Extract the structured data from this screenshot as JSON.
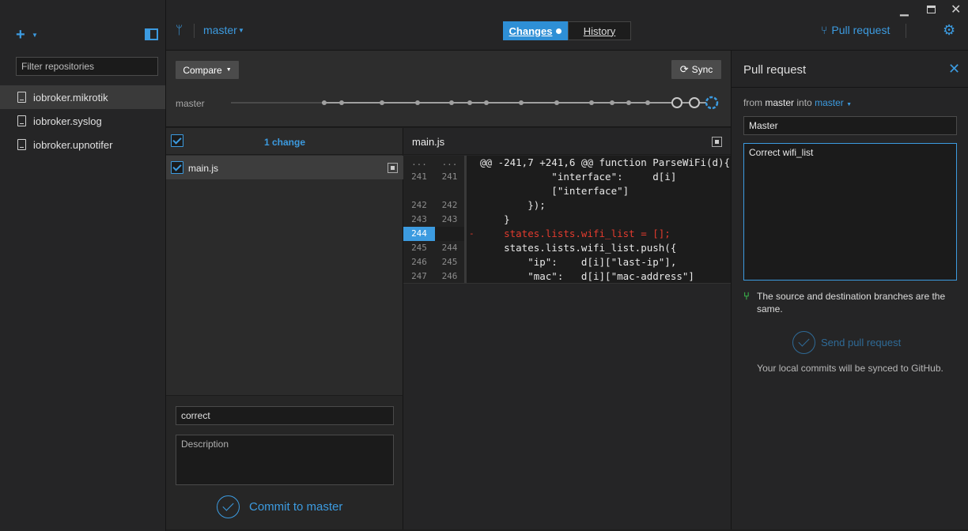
{
  "sidebar": {
    "filter_placeholder": "Filter repositories",
    "repos": [
      {
        "name": "iobroker.mikrotik",
        "active": true
      },
      {
        "name": "iobroker.syslog",
        "active": false
      },
      {
        "name": "iobroker.upnotifer",
        "active": false
      }
    ]
  },
  "topbar": {
    "branch": "master",
    "tabs": {
      "changes": "Changes",
      "history": "History"
    },
    "pull_request": "Pull request"
  },
  "compare": {
    "compare_label": "Compare",
    "sync_label": "Sync",
    "timeline_label": "master"
  },
  "changes": {
    "count_label": "1 change",
    "files": [
      {
        "name": "main.js",
        "checked": true
      }
    ]
  },
  "commit": {
    "summary_value": "correct",
    "description_placeholder": "Description",
    "button_label": "Commit to master"
  },
  "diff": {
    "filename": "main.js",
    "lines": [
      {
        "type": "hunk",
        "old": "...",
        "new": "...",
        "sign": "",
        "text": "@@ -241,7 +241,6 @@ function ParseWiFi(d){"
      },
      {
        "type": "ctx",
        "old": "241",
        "new": "241",
        "sign": "",
        "text": "            \"interface\":     d[i]"
      },
      {
        "type": "ctx",
        "old": "",
        "new": "",
        "sign": "",
        "text": "            [\"interface\"]"
      },
      {
        "type": "ctx",
        "old": "242",
        "new": "242",
        "sign": "",
        "text": "        });"
      },
      {
        "type": "ctx",
        "old": "243",
        "new": "243",
        "sign": "",
        "text": "    }"
      },
      {
        "type": "removed",
        "old": "244",
        "new": "",
        "sign": "-",
        "text": "    states.lists.wifi_list = [];"
      },
      {
        "type": "ctx",
        "old": "245",
        "new": "244",
        "sign": "",
        "text": "    states.lists.wifi_list.push({"
      },
      {
        "type": "ctx",
        "old": "246",
        "new": "245",
        "sign": "",
        "text": "        \"ip\":    d[i][\"last-ip\"],"
      },
      {
        "type": "ctx",
        "old": "247",
        "new": "246",
        "sign": "",
        "text": "        \"mac\":   d[i][\"mac-address\"]"
      }
    ]
  },
  "pr_panel": {
    "title": "Pull request",
    "from_prefix": "from",
    "from_branch": "master",
    "into_word": "into",
    "into_branch": "master",
    "title_value": "Master",
    "body_value": "Correct wifi_list",
    "warning": "The source and destination branches are the same.",
    "send_label": "Send pull request",
    "sync_note": "Your local commits will be synced to GitHub."
  },
  "colors": {
    "accent": "#3c9be0",
    "removed": "#e23b2e",
    "ok": "#3ab34a"
  },
  "icons": [
    "plus-icon",
    "sidebar-toggle-icon",
    "repo-icon",
    "branch-icon",
    "pull-request-icon",
    "gear-icon",
    "sync-icon",
    "check-icon",
    "close-icon"
  ]
}
